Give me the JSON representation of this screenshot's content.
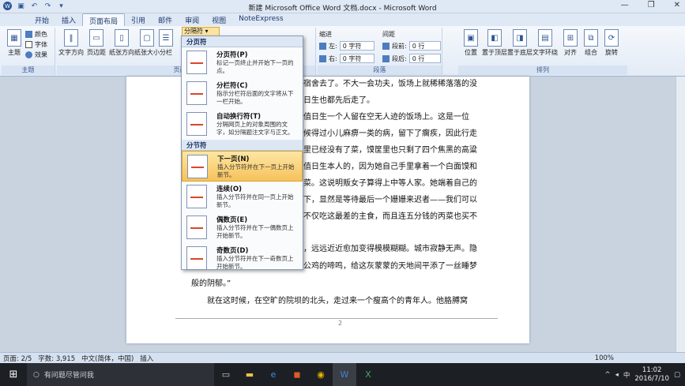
{
  "titlebar": {
    "title": "新建 Microsoft Office Word 文档.docx - Microsoft Word",
    "minimize": "—",
    "restore": "❐",
    "close": "✕"
  },
  "tabs": [
    {
      "label": "开始"
    },
    {
      "label": "插入"
    },
    {
      "label": "页面布局"
    },
    {
      "label": "引用"
    },
    {
      "label": "邮件"
    },
    {
      "label": "审阅"
    },
    {
      "label": "视图"
    },
    {
      "label": "NoteExpress"
    }
  ],
  "ribbon": {
    "theme": {
      "label": "主题",
      "colors": "颜色",
      "fonts": "字体",
      "effects": "效果",
      "group": "主题"
    },
    "page_setup": {
      "text_direction": "文字方向",
      "margins": "页边距",
      "orientation": "纸张方向",
      "size": "纸张大小",
      "columns": "分栏",
      "breaks": "分隔符",
      "group": "页面设置"
    },
    "paragraph": {
      "indent_label": "缩进",
      "spacing_label": "间距",
      "left_label": "左:",
      "right_label": "右:",
      "left_value": "0 字符",
      "right_value": "0 字符",
      "before_label": "段前:",
      "after_label": "段后:",
      "before_value": "0 行",
      "after_value": "0 行",
      "group": "段落"
    },
    "arrange": {
      "position": "位置",
      "front": "置于顶层",
      "back": "置于底层",
      "wrap": "文字环绕",
      "align": "对齐",
      "group_btn": "组合",
      "rotate": "旋转",
      "group": "排列"
    }
  },
  "menu": {
    "section1": "分页符",
    "items1": [
      {
        "title": "分页符(P)",
        "desc1": "标记一页终止并开始下一页的",
        "desc2": "点。"
      },
      {
        "title": "分栏符(C)",
        "desc1": "指示分栏符后面的文字将从下",
        "desc2": "一栏开始。"
      },
      {
        "title": "自动换行符(T)",
        "desc1": "分隔网页上的对象周围的文",
        "desc2": "字，如分隔题注文字与正文。"
      }
    ],
    "section2": "分节符",
    "items2": [
      {
        "title": "下一页(N)",
        "desc1": "插入分节符并在下一页上开始",
        "desc2": "新节。"
      },
      {
        "title": "连续(O)",
        "desc1": "插入分节符并在同一页上开始",
        "desc2": "新节。"
      },
      {
        "title": "偶数页(E)",
        "desc1": "插入分节符并在下一偶数页上",
        "desc2": "开始新节。"
      },
      {
        "title": "奇数页(D)",
        "desc1": "插入分节符并在下一奇数页上",
        "desc2": "开始新节。"
      }
    ]
  },
  "document": {
    "lines": [
      "宿舍去了。不大一会功夫，饭场上就稀稀落落的没",
      "日生也都先后走了。",
      "值日生一个人留在空无人迹的饭场上。这是一位",
      "候得过小儿麻痹一类的病，留下了瘸疾，因此行走",
      "里已经没有了菜，馍筐里也只剩了四个焦黑的高粱",
      "值日生本人的，因为她自己手里拿着一个白面馍和",
      "菜。这说明贩女子算得上中等人家。她端着自己的",
      "下，显然是等待最后一个姗姗来迟者——我们可以",
      "不仅吃这最差的主食，而且连五分钱的丙菜也买不",
      "，远远近近愈加变得模模糊糊。城市寂静无声。隐",
      "公鸡的啼鸣，给这灰蒙蒙的天地间平添了一丝睡梦",
      "般的阴郁。”",
      "就在这时候，在空旷的院坝的北头，走过来一个瘦高个的青年人。他胳膊窝"
    ],
    "page_marker": "2"
  },
  "status": {
    "page": "页面: 2/5",
    "words": "字数: 3,915",
    "lang": "中文(简体，中国)",
    "mode": "插入",
    "zoom": "100%"
  },
  "taskbar": {
    "search_placeholder": "有问题尽管问我",
    "time": "11:02",
    "date": "2016/7/10",
    "ime": "中"
  }
}
